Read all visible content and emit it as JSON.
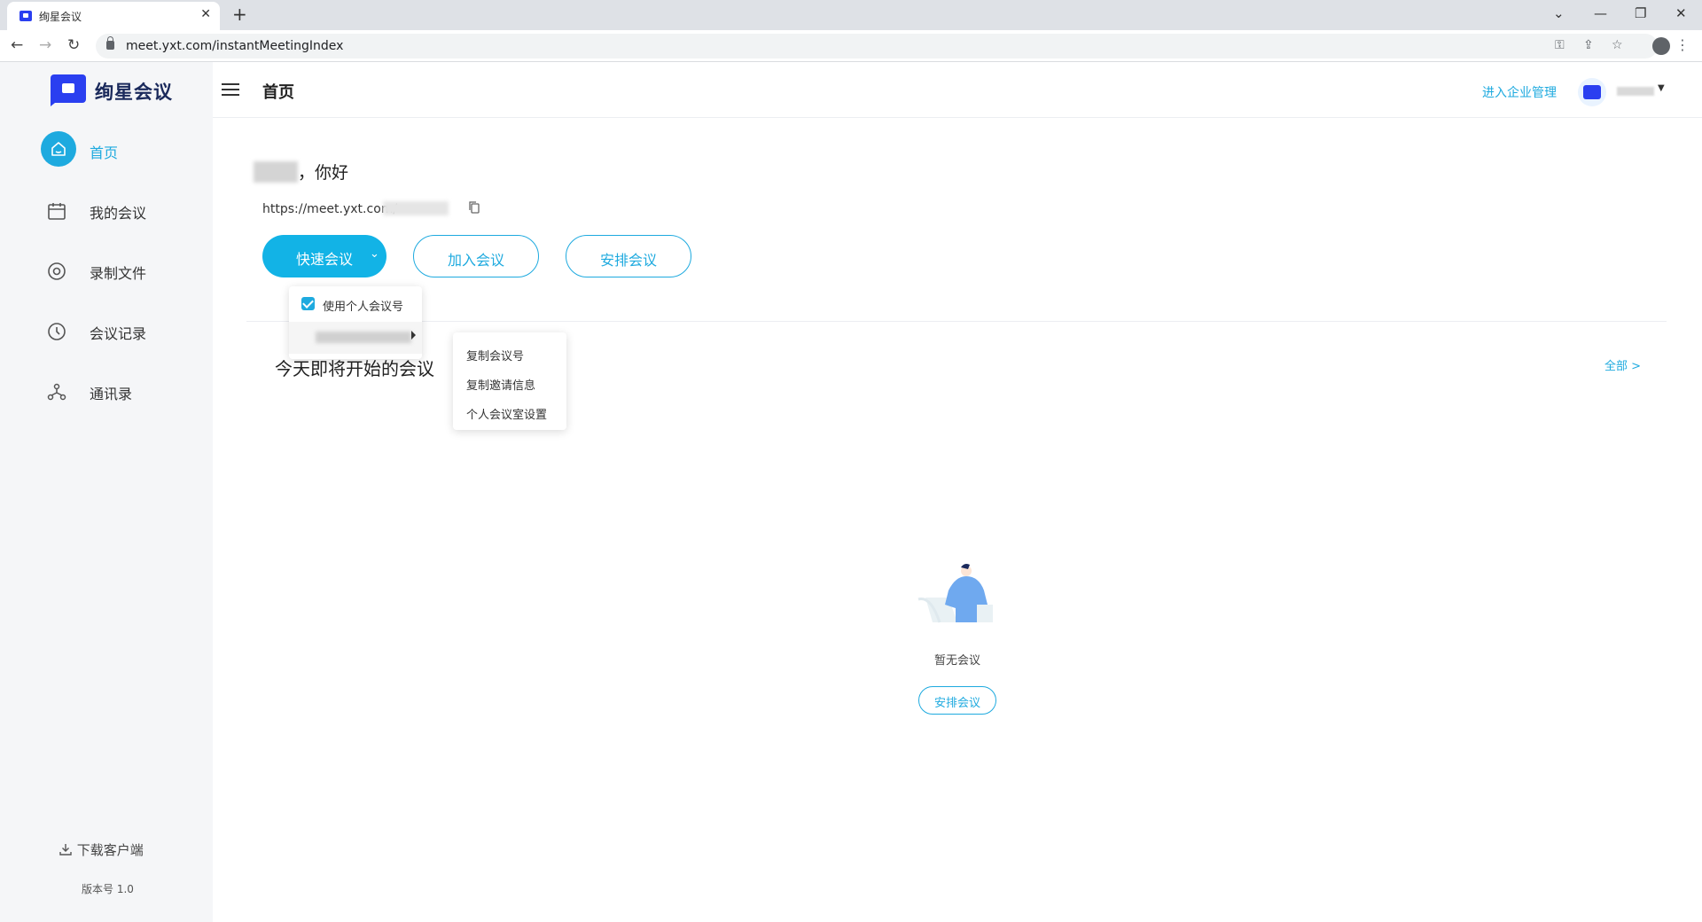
{
  "browser": {
    "tab_title": "绚星会议",
    "tab_close": "✕",
    "new_tab": "+",
    "url": "meet.yxt.com/instantMeetingIndex",
    "back": "←",
    "forward": "→",
    "reload": "↻",
    "min": "—",
    "restore": "❐",
    "close": "✕",
    "dropdown": "⌄",
    "menu": "⋮"
  },
  "app": {
    "logo_text": "绚星会议",
    "page_title": "首页",
    "enterprise_link": "进入企业管理",
    "caret": "▼"
  },
  "sidebar": {
    "items": [
      {
        "label": "首页",
        "icon": "home-icon",
        "active": true
      },
      {
        "label": "我的会议",
        "icon": "calendar-icon"
      },
      {
        "label": "录制文件",
        "icon": "record-icon"
      },
      {
        "label": "会议记录",
        "icon": "clock-icon"
      },
      {
        "label": "通讯录",
        "icon": "contacts-icon"
      }
    ],
    "download": "下载客户端",
    "version": "版本号 1.0"
  },
  "main": {
    "greeting": "，你好",
    "meet_url": "https://meet.yxt.com/",
    "quick_meeting": "快速会议",
    "quick_caret": "⌄",
    "join_meeting": "加入会议",
    "schedule_meeting": "安排会议",
    "upcoming_title": "今天即将开始的会议",
    "all_link": "全部 >",
    "empty_text": "暂无会议",
    "empty_button": "安排会议"
  },
  "dropdown": {
    "use_personal_id": "使用个人会议号",
    "use_personal_checked": true,
    "submenu": [
      "复制会议号",
      "复制邀请信息",
      "个人会议室设置"
    ]
  },
  "colors": {
    "accent": "#1eaadf",
    "primary_button": "#12b3e6",
    "brand_blue": "#2a3ff0",
    "sidebar_bg": "#f5f6f8"
  }
}
